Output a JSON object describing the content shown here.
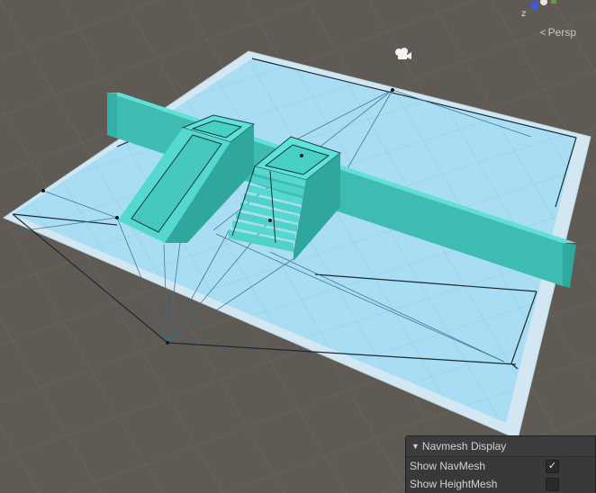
{
  "viewport": {
    "projection_label": "Persp",
    "gizmo_axis_label": "z"
  },
  "navmesh_panel": {
    "title": "Navmesh Display",
    "options": [
      {
        "label": "Show NavMesh",
        "checked": true
      },
      {
        "label": "Show HeightMesh",
        "checked": false
      }
    ]
  },
  "icons": [
    "camera-icon",
    "scene-gizmo-icon",
    "collapse-triangle-icon",
    "checkmark-icon"
  ],
  "colors": {
    "ground_dark": "#5f5a54",
    "navmesh_fill": "#a6dcf4",
    "navmesh_border": "#d9ecf7",
    "geometry": "#4fd2c8",
    "panel_bg": "#393939"
  }
}
